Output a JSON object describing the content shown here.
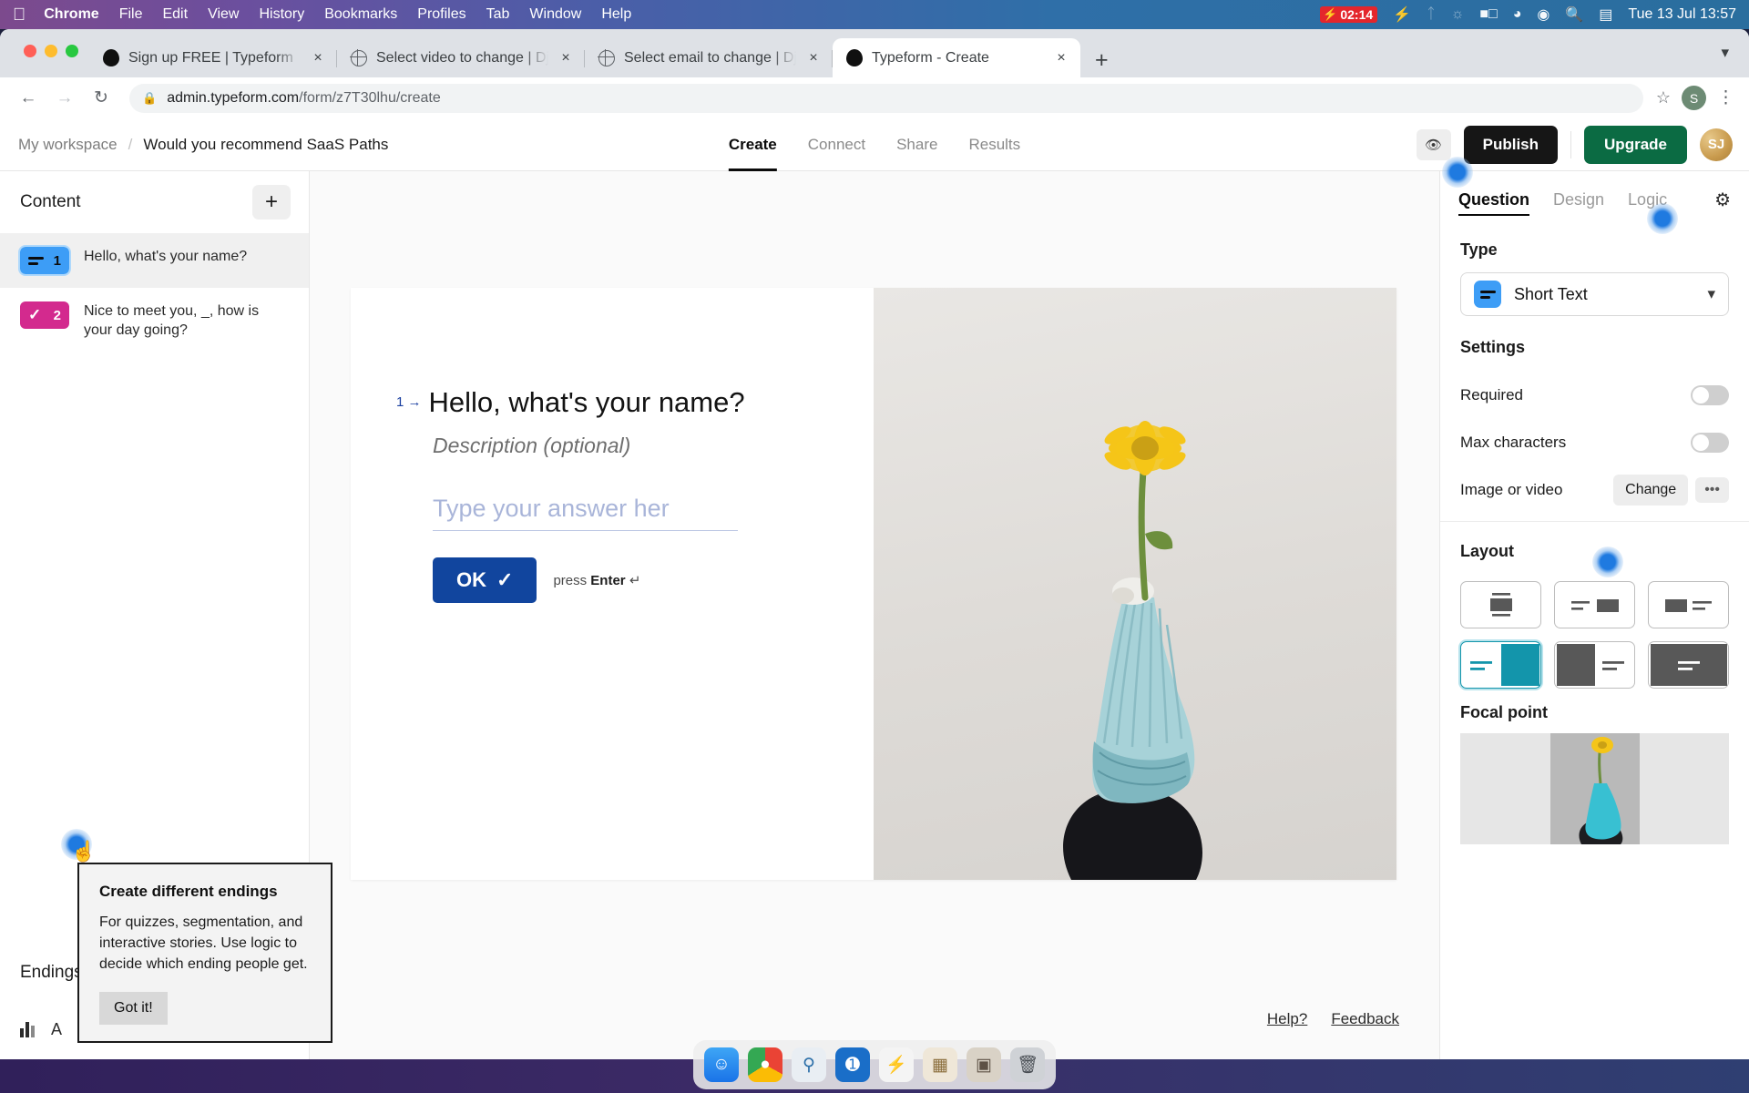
{
  "menubar": {
    "apple_icon": "apple-logo",
    "items": [
      "Chrome",
      "File",
      "Edit",
      "View",
      "History",
      "Bookmarks",
      "Profiles",
      "Tab",
      "Window",
      "Help"
    ],
    "recording_time": "02:14",
    "status_icons": [
      "bolt-icon",
      "bluetooth-icon",
      "keyboard-brightness-icon",
      "battery-icon",
      "wifi-icon",
      "control-center-icon",
      "search-icon",
      "display-icon"
    ],
    "clock": "Tue 13 Jul  13:57"
  },
  "browser": {
    "tabs": [
      {
        "title": "Sign up FREE | Typeform",
        "favicon": "typeform-dot-icon",
        "active": false
      },
      {
        "title": "Select video to change | Djang",
        "favicon": "globe-icon",
        "active": false
      },
      {
        "title": "Select email to change | Djang",
        "favicon": "globe-icon",
        "active": false
      },
      {
        "title": "Typeform - Create",
        "favicon": "typeform-dot-icon",
        "active": true
      }
    ],
    "new_tab_label": "+",
    "close_label": "×",
    "back_icon": "←",
    "forward_icon": "→",
    "reload_icon": "↻",
    "lock_icon": "🔒",
    "url_host": "admin.typeform.com",
    "url_path": "/form/z7T30lhu/create",
    "star_icon": "☆",
    "profile_initial": "S",
    "menu_icon": "⋮",
    "window_caret": "▾"
  },
  "app_header": {
    "workspace": "My workspace",
    "separator": "/",
    "form_name": "Would you recommend SaaS Paths",
    "tabs": [
      {
        "label": "Create",
        "active": true
      },
      {
        "label": "Connect",
        "active": false
      },
      {
        "label": "Share",
        "active": false
      },
      {
        "label": "Results",
        "active": false
      }
    ],
    "preview_icon": "eye-icon",
    "publish_label": "Publish",
    "upgrade_label": "Upgrade",
    "avatar_initials": "SJ"
  },
  "sidebar": {
    "title": "Content",
    "add_label": "+",
    "questions": [
      {
        "number": "1",
        "text": "Hello, what's your name?",
        "badge_color": "#3d9df6",
        "icon": "short-text-icon",
        "selected": true
      },
      {
        "number": "2",
        "text": "Nice to meet you, _, how is your day going?",
        "badge_color": "#d32a8e",
        "icon": "check-icon",
        "selected": false
      }
    ],
    "endings_label": "Endings",
    "footer_icons": [
      "bars-icon",
      "letter-a-icon"
    ],
    "footer_letter": "A"
  },
  "canvas": {
    "question_number": "1",
    "arrow_icon": "→",
    "question_title": "Hello, what's your name?",
    "description_placeholder": "Description (optional)",
    "answer_placeholder": "Type your answer her",
    "ok_label": "OK",
    "ok_check_icon": "✓",
    "press_prefix": "press ",
    "press_key": "Enter",
    "press_return_icon": "↵",
    "help_label": "Help?",
    "feedback_label": "Feedback"
  },
  "right_panel": {
    "tabs": [
      {
        "label": "Question",
        "active": true
      },
      {
        "label": "Design",
        "active": false
      },
      {
        "label": "Logic",
        "active": false
      }
    ],
    "gear_icon": "gear-icon",
    "type_label": "Type",
    "type_value": "Short Text",
    "type_icon": "short-text-icon",
    "chevron_icon": "⌄",
    "settings_label": "Settings",
    "required_label": "Required",
    "required_on": false,
    "max_characters_label": "Max characters",
    "max_characters_on": false,
    "image_or_video_label": "Image or video",
    "change_label": "Change",
    "more_label": "•••",
    "layout_label": "Layout",
    "layout_selected_index": 3,
    "layout_options": [
      "stacked-top",
      "text-left-image-right-small",
      "image-left-small-text-right",
      "text-left-image-right-full",
      "image-left-full-text-right",
      "full-background"
    ],
    "focal_point_label": "Focal point",
    "accent_color": "#1395ab"
  },
  "tooltip": {
    "title": "Create different endings",
    "body": "For quizzes, segmentation, and interactive stories. Use logic to decide which ending people get.",
    "button_label": "Got it!"
  },
  "dock": {
    "items": [
      "finder-icon",
      "chrome-icon",
      "preview-icon",
      "1password-icon",
      "bolt-icon",
      "notes-icon",
      "screens-icon",
      "trash-icon"
    ]
  }
}
